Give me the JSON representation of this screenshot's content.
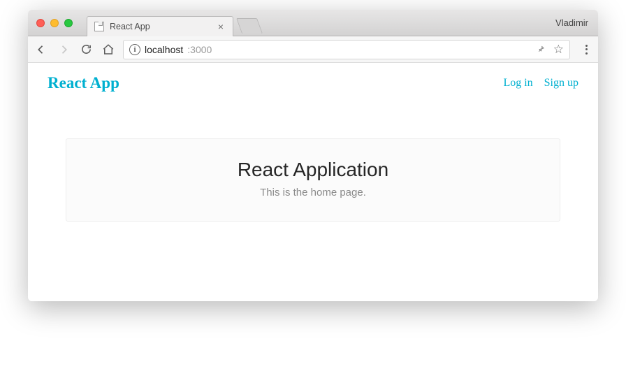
{
  "browser": {
    "profile_name": "Vladimir",
    "tab": {
      "title": "React App"
    },
    "address": {
      "host": "localhost",
      "port": ":3000"
    }
  },
  "header": {
    "brand": "React App",
    "links": {
      "login": "Log in",
      "signup": "Sign up"
    }
  },
  "main": {
    "title": "React Application",
    "subtitle": "This is the home page."
  }
}
